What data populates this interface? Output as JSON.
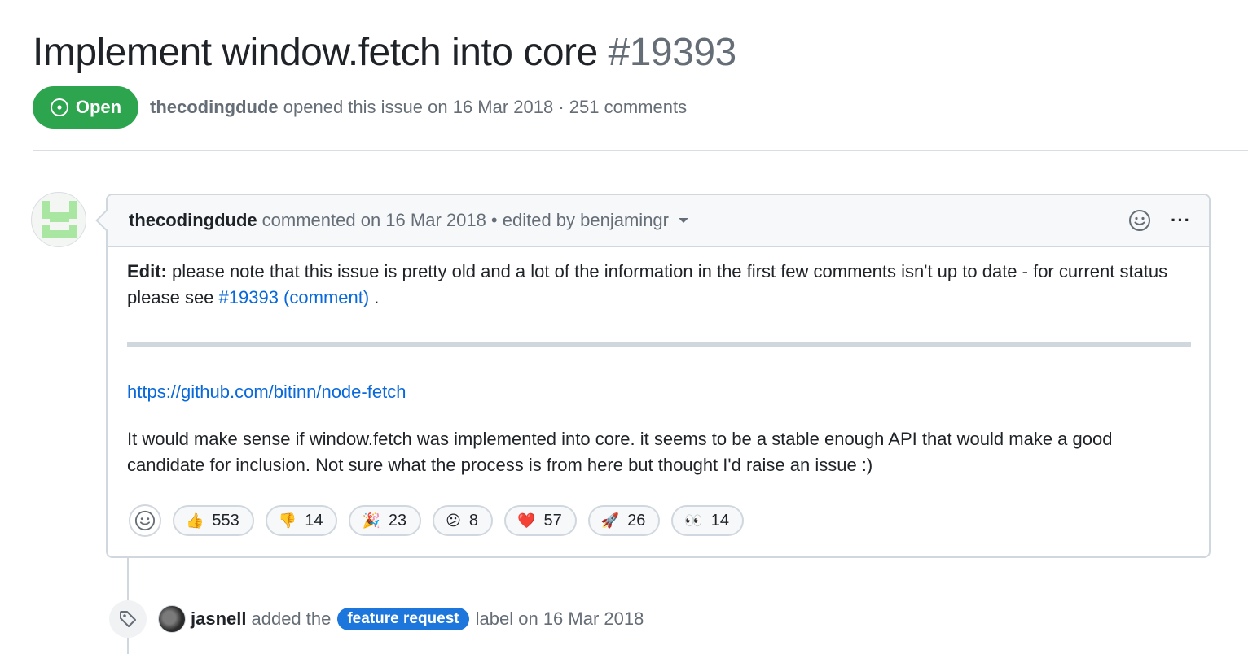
{
  "issue": {
    "title": "Implement window.fetch into core",
    "number": "#19393",
    "state": "Open",
    "author": "thecodingdude",
    "opened_text": "opened this issue on 16 Mar 2018 · 251 comments"
  },
  "comment": {
    "author": "thecodingdude",
    "meta": "commented on 16 Mar 2018 • edited by benjamingr",
    "body": {
      "edit_label": "Edit:",
      "edit_text": " please note that this issue is pretty old and a lot of the information in the first few comments isn't up to date - for current status please see ",
      "edit_link": "#19393 (comment)",
      "edit_end": " .",
      "url": "https://github.com/bitinn/node-fetch",
      "paragraph": "It would make sense if window.fetch was implemented into core. it seems to be a stable enough API that would make a good candidate for inclusion. Not sure what the process is from here but thought I'd raise an issue :)"
    },
    "reactions": [
      {
        "emoji": "👍",
        "count": "553"
      },
      {
        "emoji": "👎",
        "count": "14"
      },
      {
        "emoji": "🎉",
        "count": "23"
      },
      {
        "emoji": "😕",
        "count": "8"
      },
      {
        "emoji": "❤️",
        "count": "57"
      },
      {
        "emoji": "🚀",
        "count": "26"
      },
      {
        "emoji": "👀",
        "count": "14"
      }
    ]
  },
  "event": {
    "actor": "jasnell",
    "pre": "added the",
    "label": "feature request",
    "post": "label on 16 Mar 2018"
  },
  "colors": {
    "open_green": "#2da44e",
    "link_blue": "#0969da",
    "label_blue": "#1d76db",
    "identicon_green": "#a8e6a1"
  },
  "icons": [
    "issue-open-icon",
    "smiley-icon",
    "kebab-icon",
    "tag-icon",
    "caret-down-icon"
  ]
}
